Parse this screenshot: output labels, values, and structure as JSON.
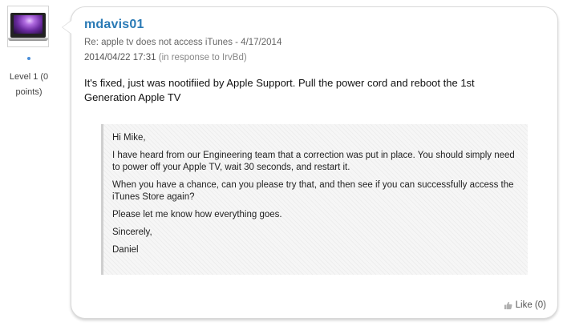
{
  "author": {
    "avatar_icon": "laptop-avatar-icon",
    "level_line1": "Level 1 (0",
    "level_line2": "points)"
  },
  "post": {
    "username": "mdavis01",
    "subject": "Re: apple tv does not access iTunes - 4/17/2014",
    "date": "2014/04/22 17:31",
    "in_response": "(in response to IrvBd)",
    "body_line1": "It's fixed, just was nootifiied by Apple Support.  Pull the power cord and reboot the 1st",
    "body_line2": "Generation Apple TV",
    "quote": {
      "greeting": "Hi Mike,",
      "para1": "I have heard from our Engineering team that a correction was put in place. You should simply need to power off your Apple TV, wait 30 seconds, and restart it.",
      "para2": "When you have a chance, can you please try that, and then see if you can successfully access the iTunes Store again?",
      "para3": "Please let me know how everything goes.",
      "closing": "Sincerely,",
      "signature": "Daniel"
    },
    "like_label": "Like (0)",
    "like_icon": "thumbs-up-icon"
  },
  "colors": {
    "username": "#2a7ab5",
    "status_dot": "#4a8ed8",
    "card_border": "#d9d9d9"
  }
}
